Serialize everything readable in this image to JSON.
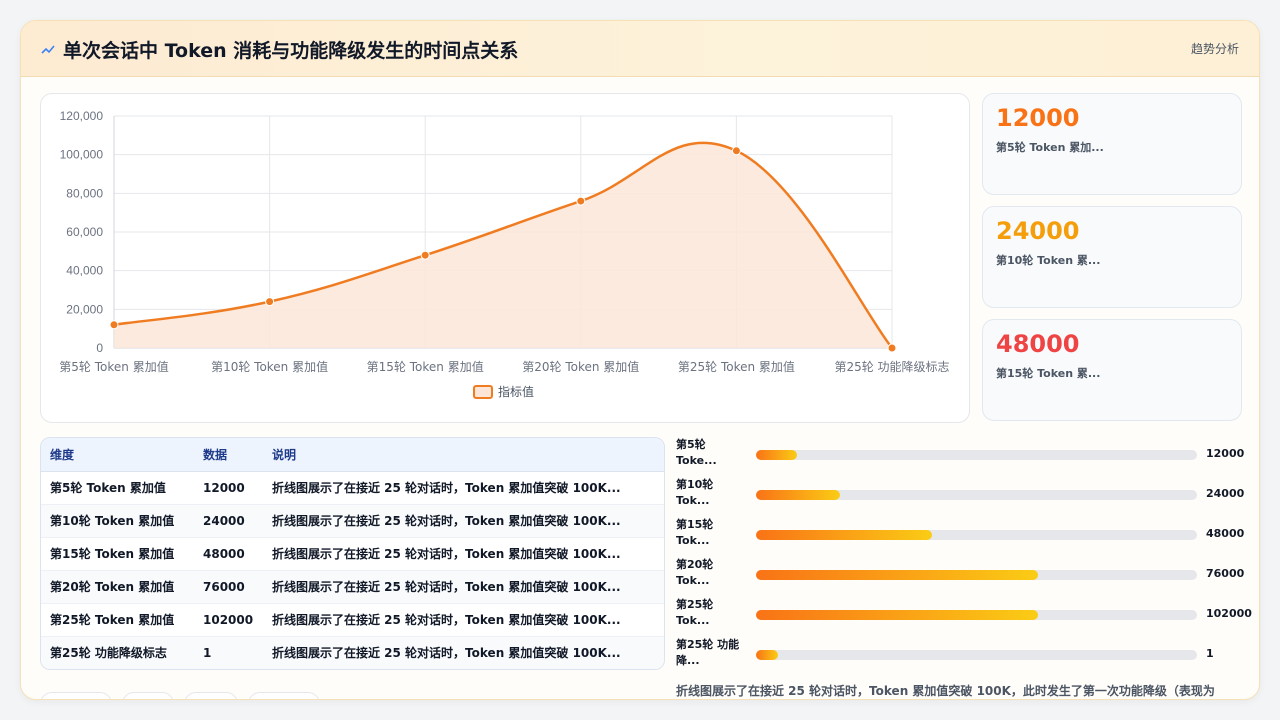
{
  "header": {
    "title": "单次会话中 Token 消耗与功能降级发生的时间点关系",
    "action_label": "趋势分析",
    "icon": "trend-line-icon"
  },
  "chart_data": {
    "type": "area",
    "categories": [
      "第5轮 Token 累加值",
      "第10轮 Token 累加值",
      "第15轮 Token 累加值",
      "第20轮 Token 累加值",
      "第25轮 Token 累加值",
      "第25轮 功能降级标志"
    ],
    "series": [
      {
        "name": "指标值",
        "values": [
          12000,
          24000,
          48000,
          76000,
          102000,
          1
        ]
      }
    ],
    "ylim": [
      0,
      120000
    ],
    "yticks": [
      "0",
      "20,000",
      "40,000",
      "60,000",
      "80,000",
      "100,000",
      "120,000"
    ],
    "grid": true,
    "legend": "bottom",
    "colors": {
      "line": "#f07c22",
      "fill": "#fde6d8"
    }
  },
  "kpis": [
    {
      "value": "12000",
      "label": "第5轮 Token 累加...",
      "color": "#f97316"
    },
    {
      "value": "24000",
      "label": "第10轮 Token 累...",
      "color": "#f59e0b"
    },
    {
      "value": "48000",
      "label": "第15轮 Token 累...",
      "color": "#ef4444"
    }
  ],
  "table": {
    "headers": [
      "维度",
      "数据",
      "说明"
    ],
    "rows": [
      [
        "第5轮 Token 累加值",
        "12000",
        "折线图展示了在接近 25 轮对话时，Token 累加值突破 100K..."
      ],
      [
        "第10轮 Token 累加值",
        "24000",
        "折线图展示了在接近 25 轮对话时，Token 累加值突破 100K..."
      ],
      [
        "第15轮 Token 累加值",
        "48000",
        "折线图展示了在接近 25 轮对话时，Token 累加值突破 100K..."
      ],
      [
        "第20轮 Token 累加值",
        "76000",
        "折线图展示了在接近 25 轮对话时，Token 累加值突破 100K..."
      ],
      [
        "第25轮 Token 累加值",
        "102000",
        "折线图展示了在接近 25 轮对话时，Token 累加值突破 100K..."
      ],
      [
        "第25轮 功能降级标志",
        "1",
        "折线图展示了在接近 25 轮对话时，Token 累加值突破 100K..."
      ]
    ]
  },
  "bars": [
    {
      "l1": "第5轮",
      "l2": "Toke...",
      "value": "12000",
      "fraction": 0.094
    },
    {
      "l1": "第10轮",
      "l2": "Tok...",
      "value": "24000",
      "fraction": 0.19
    },
    {
      "l1": "第15轮",
      "l2": "Tok...",
      "value": "48000",
      "fraction": 0.4
    },
    {
      "l1": "第20轮",
      "l2": "Tok...",
      "value": "76000",
      "fraction": 0.64
    },
    {
      "l1": "第25轮",
      "l2": "Tok...",
      "value": "102000",
      "fraction": 0.64
    },
    {
      "l1": "第25轮 功能",
      "l2": "降...",
      "value": "1",
      "fraction": 0.05
    }
  ],
  "summary": "折线图展示了在接近 25 轮对话时，Token 累加值突破 100K，此时发生了第一次功能降级（表现为"
}
